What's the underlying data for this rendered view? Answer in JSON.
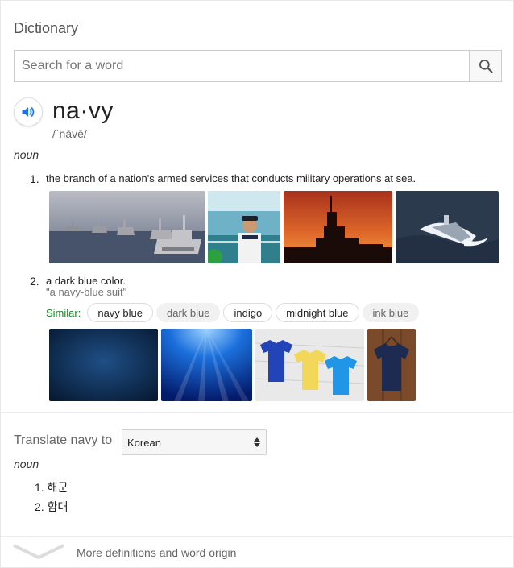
{
  "dictionary": {
    "title": "Dictionary",
    "search": {
      "placeholder": "Search for a word",
      "value": ""
    },
    "icons": {
      "search": "search-icon",
      "audio": "speaker-icon",
      "select": "updown-arrows-icon",
      "more": "chevron-down-icon"
    },
    "entry": {
      "word": "na·vy",
      "phonetic": "/ˈnāvē/",
      "part_of_speech": "noun",
      "definitions": [
        {
          "number": "1.",
          "text": "the branch of a nation's armed services that conducts military operations at sea.",
          "images": [
            "fleet-of-warships-photo",
            "naval-officer-photo",
            "warship-sunset-photo",
            "patrol-boat-photo"
          ]
        },
        {
          "number": "2.",
          "text": "a dark blue color.",
          "example": "\"a navy-blue suit\"",
          "similar_label": "Similar:",
          "similar": [
            {
              "label": "navy blue",
              "style": "outlined"
            },
            {
              "label": "dark blue",
              "style": "muted"
            },
            {
              "label": "indigo",
              "style": "outlined"
            },
            {
              "label": "midnight blue",
              "style": "outlined"
            },
            {
              "label": "ink blue",
              "style": "muted"
            }
          ],
          "images": [
            "navy-gradient-photo",
            "underwater-blue-photo",
            "polo-shirts-photo",
            "navy-tshirt-photo"
          ]
        }
      ]
    },
    "translate": {
      "label": "Translate navy to",
      "language": "Korean",
      "part_of_speech": "noun",
      "items": [
        {
          "number": "1.",
          "text": "해군"
        },
        {
          "number": "2.",
          "text": "함대"
        }
      ]
    },
    "more_link": "More definitions and word origin"
  }
}
